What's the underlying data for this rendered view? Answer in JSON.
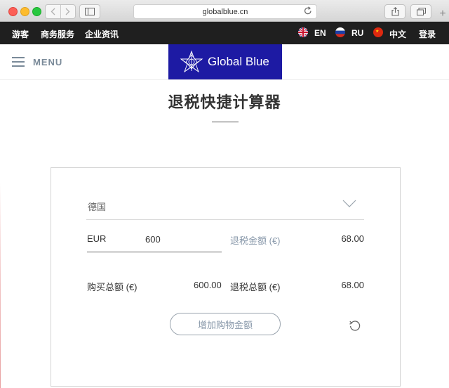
{
  "browser": {
    "url": "globalblue.cn",
    "new_tab": "+"
  },
  "topnav": {
    "links": [
      "游客",
      "商务服务",
      "企业资讯"
    ],
    "languages": [
      {
        "code": "EN",
        "flag": "uk-flag-icon"
      },
      {
        "code": "RU",
        "flag": "russia-flag-icon"
      },
      {
        "code": "中文",
        "flag": "china-flag-icon"
      }
    ],
    "login": "登录"
  },
  "header": {
    "menu_label": "MENU",
    "logo_text": "Global Blue",
    "brand_color": "#1d1aa3"
  },
  "page": {
    "title": "退税快捷计算器"
  },
  "calculator": {
    "country": "德国",
    "currency": "EUR",
    "amount": "600",
    "refund_label": "退税金额 (€)",
    "refund_value": "68.00",
    "purchase_total_label": "购买总额 (€)",
    "purchase_total_value": "600.00",
    "refund_total_label": "退税总额 (€)",
    "refund_total_value": "68.00",
    "add_button": "增加购物金额"
  }
}
